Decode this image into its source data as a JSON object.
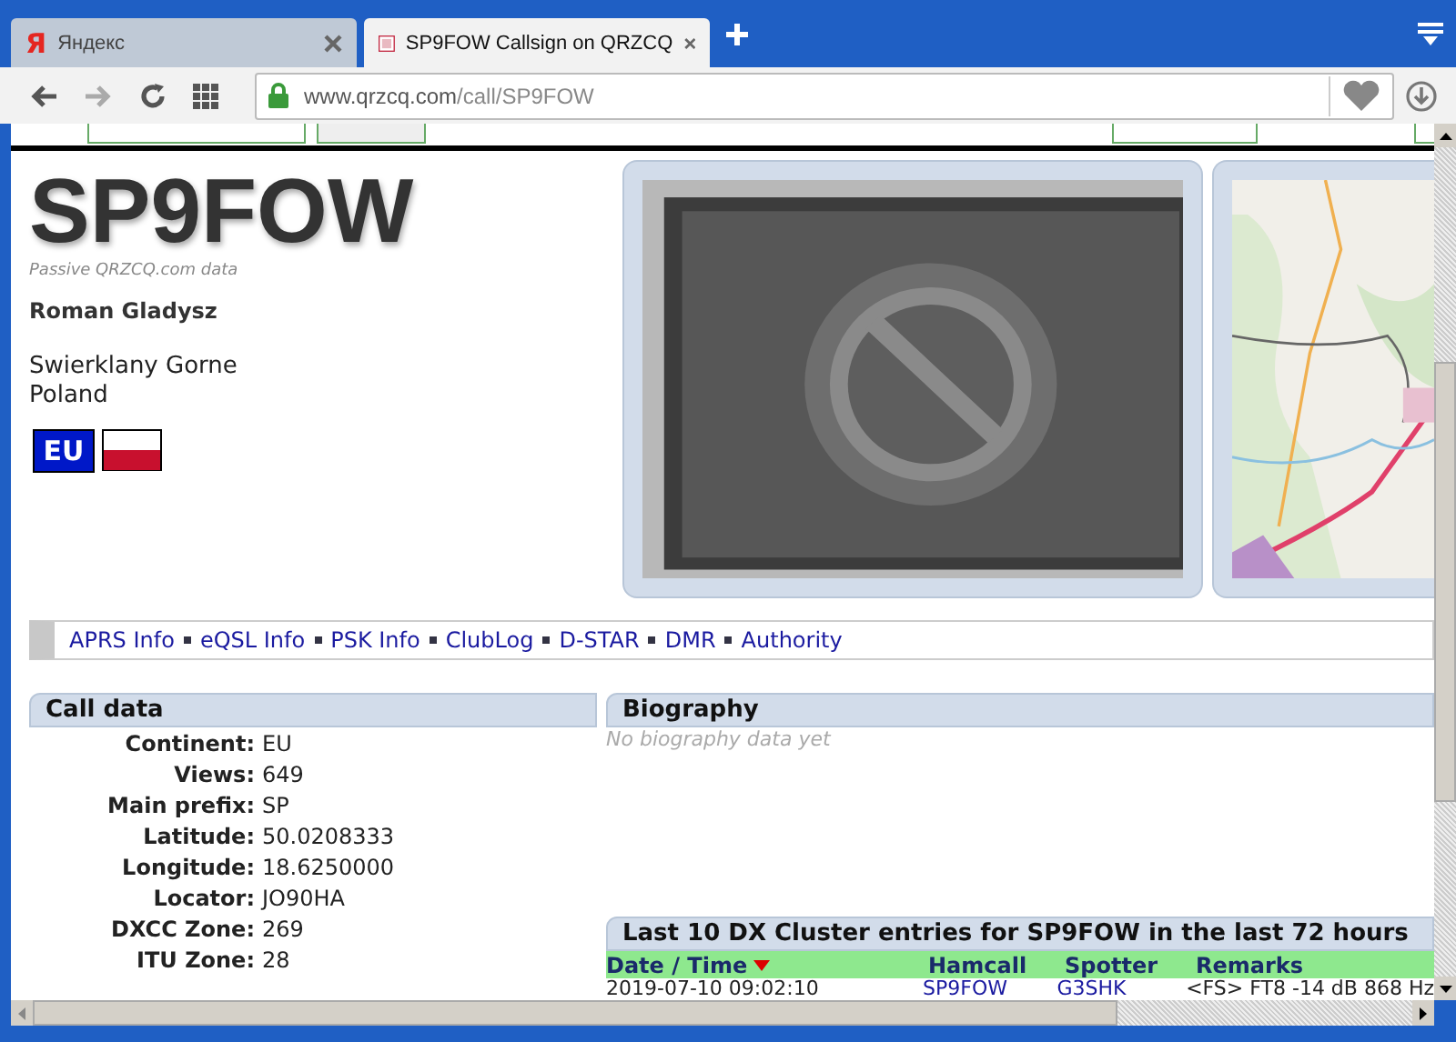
{
  "browser": {
    "tabs": [
      {
        "title": "Яндекс",
        "icon_text": "Я",
        "selected": false
      },
      {
        "title": "SP9FOW Callsign on QRZCQ",
        "selected": true
      }
    ],
    "url": {
      "domain": "www.qrzcq.com",
      "path": "/call/SP9FOW"
    }
  },
  "profile": {
    "callsign": "SP9FOW",
    "source_note": "Passive QRZCQ.com data",
    "name": "Roman Gladysz",
    "address": [
      "Swierklany Gorne",
      "Poland"
    ],
    "continent_badge": "EU"
  },
  "links": [
    "APRS Info",
    "eQSL Info",
    "PSK Info",
    "ClubLog",
    "D-STAR",
    "DMR",
    "Authority"
  ],
  "call_data": {
    "title": "Call data",
    "rows": [
      {
        "label": "Continent:",
        "value": "EU"
      },
      {
        "label": "Views:",
        "value": "649"
      },
      {
        "label": "Main prefix:",
        "value": "SP"
      },
      {
        "label": "Latitude:",
        "value": "50.0208333"
      },
      {
        "label": "Longitude:",
        "value": "18.6250000"
      },
      {
        "label": "Locator:",
        "value": "JO90HA"
      },
      {
        "label": "DXCC Zone:",
        "value": "269"
      },
      {
        "label": "ITU Zone:",
        "value": "28"
      }
    ]
  },
  "biography": {
    "title": "Biography",
    "empty_text": "No biography data yet"
  },
  "dx_cluster": {
    "title": "Last 10 DX Cluster entries for SP9FOW in the last 72 hours",
    "columns": [
      {
        "label": "Date / Time",
        "sorted": true
      },
      {
        "label": "Hamcall",
        "sorted": false
      },
      {
        "label": "Spotter",
        "sorted": false
      },
      {
        "label": "Remarks",
        "sorted": false
      }
    ],
    "rows": [
      {
        "cells": [
          "2019-07-10 09:02:10",
          "SP9FOW",
          "G3SHK",
          "<FS> FT8 -14 dB 868 Hz"
        ],
        "links": [
          false,
          true,
          true,
          false
        ]
      }
    ]
  }
}
